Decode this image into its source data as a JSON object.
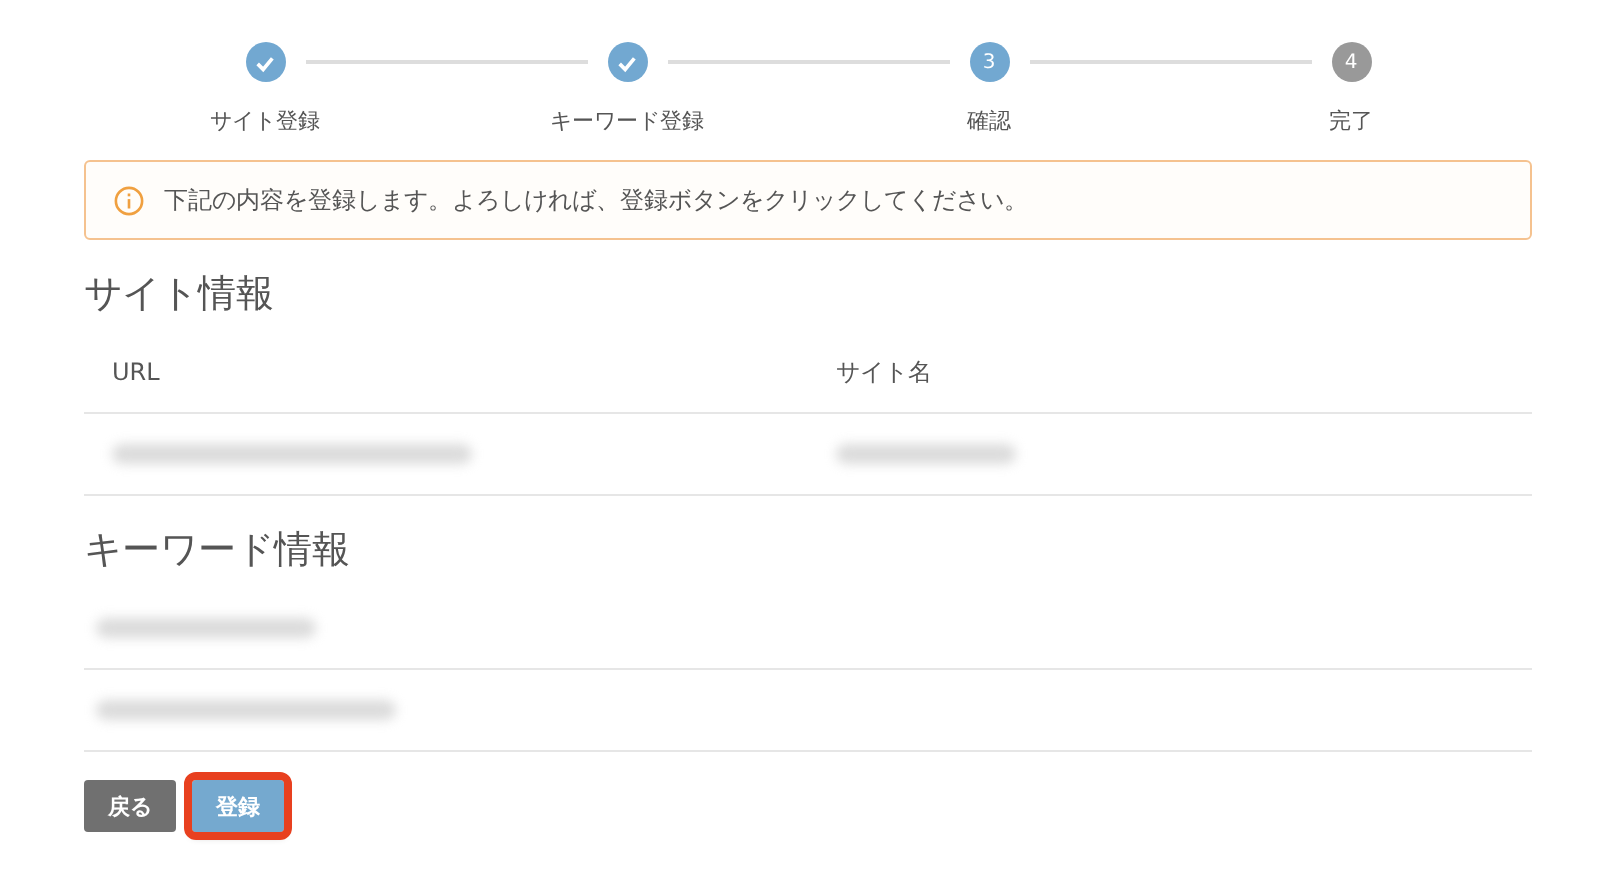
{
  "steps": [
    {
      "label": "サイト登録",
      "kind": "done"
    },
    {
      "label": "キーワード登録",
      "kind": "done"
    },
    {
      "label": "確認",
      "kind": "current",
      "number": "3"
    },
    {
      "label": "完了",
      "kind": "pending",
      "number": "4"
    }
  ],
  "alert": {
    "text": "下記の内容を登録します。よろしければ、登録ボタンをクリックしてください。"
  },
  "site_section": {
    "title": "サイト情報",
    "columns": [
      "URL",
      "サイト名"
    ],
    "rows": [
      [
        {
          "redacted": true
        },
        {
          "redacted": true
        }
      ]
    ]
  },
  "keyword_section": {
    "title": "キーワード情報",
    "rows": [
      {
        "redacted": true
      },
      {
        "redacted": true
      }
    ]
  },
  "buttons": [
    {
      "label": "戻る",
      "kind": "secondary",
      "highlighted": false
    },
    {
      "label": "登録",
      "kind": "primary",
      "highlighted": true
    }
  ]
}
